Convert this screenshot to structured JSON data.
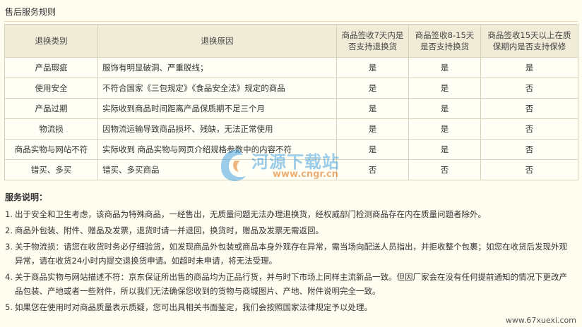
{
  "section_title": "售后服务规则",
  "table": {
    "headers": [
      "退换类别",
      "退换原因",
      "商品签收7天内是否支持退换货",
      "商品签收8-15天是否支持换货",
      "商品签收15天以上在质保期内是否支持保修"
    ],
    "rows": [
      {
        "category": "产品瑕疵",
        "reason": "服饰有明显破洞、严重脱线；",
        "d7": "是",
        "d15": "是",
        "warranty": "是"
      },
      {
        "category": "使用安全",
        "reason": "不符合国家《三包规定》《食品安全法》规定的商品",
        "d7": "是",
        "d15": "是",
        "warranty": "否"
      },
      {
        "category": "产品过期",
        "reason": "实际收到商品时间距离产品保质期不足三个月",
        "d7": "是",
        "d15": "是",
        "warranty": "否"
      },
      {
        "category": "物流损",
        "reason": "因物流运输导致商品损坏、残缺，无法正常使用",
        "d7": "是",
        "d15": "是",
        "warranty": "否"
      },
      {
        "category": "商品实物与网站不符",
        "reason": "实际收到 商品实物与网页介绍规格参数中的内容不符",
        "d7": "是",
        "d15": "是",
        "warranty": "否"
      },
      {
        "category": "错买、多买",
        "reason": "错买、多买商品",
        "d7": "否",
        "d15": "否",
        "warranty": "否"
      }
    ]
  },
  "notes": {
    "title": "服务说明：",
    "items": [
      {
        "num": "1.",
        "text": "出于安全和卫生考虑，该商品为特殊商品，一经售出，无质量问题无法办理退换货，经权威部门检测商品存在内在质量问题者除外。"
      },
      {
        "num": "2.",
        "text": "商品外包装、附件、赠品及发票，退货时请一并退回，换货时，赠品及发票无需返回。"
      },
      {
        "num": "3.",
        "text": "关于物流损：请您在收货时务必仔细验货，如发现商品外包装或商品本身外观存在异常，需当场向配送人员指出，并拒收整个包裹；如您在收货后发现外观异常，请在收货24小时内提交退换货申请。如超时未申请，将无法受理。"
      },
      {
        "num": "4.",
        "text": "关于商品实物与网站描述不符：京东保证所出售的商品均为正品行货，并与时下市场上同样主流新品一致。但因厂家会在没有任何提前通知的情况下更改产品包装、产地或者一些附件，所以我们无法确保您收到的货物与商城图片、产地、附件说明完全一致。"
      },
      {
        "num": "5.",
        "text": "如果您在使用时对商品质量表示质疑，您可出具相关书面鉴定，我们会按照国家法律规定予以处理。"
      }
    ]
  },
  "watermark": {
    "brand": "河源下载站",
    "url": "www.cngr.cn"
  },
  "corner_url": "www.67xuexi.com",
  "colors": {
    "background": "#fffdf0",
    "header_bg": "#f1ecd8",
    "border": "#d9d2ba",
    "watermark_blue": "#4aa3e0",
    "watermark_orange": "#e07a20"
  }
}
